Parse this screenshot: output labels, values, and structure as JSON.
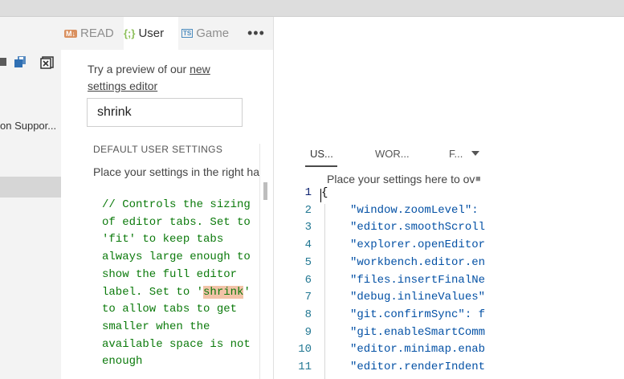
{
  "sidebar": {
    "text": "on Suppor..."
  },
  "tabs": [
    {
      "icon": "M↓",
      "label": "READ"
    },
    {
      "icon": "{;}",
      "label": "User"
    },
    {
      "icon": "TS",
      "label": "Game"
    }
  ],
  "tabs_more": "•••",
  "preview": {
    "text": "Try a preview of our ",
    "link": "new settings editor"
  },
  "search": {
    "value": "shrink"
  },
  "default_settings": {
    "header": "DEFAULT USER SETTINGS",
    "place_text": "Place your settings in the right ha",
    "comment_before": "// Controls the sizing of editor tabs. Set to 'fit' to keep tabs always large enough to show the full editor label. Set to '",
    "comment_highlight": "shrink",
    "comment_after": "' to allow tabs to get smaller when the available space is not enough"
  },
  "right_tabs": {
    "user": "US...",
    "workspace": "WOR...",
    "folder": "F..."
  },
  "right_place_text": "Place your settings here to ov",
  "code_lines": [
    {
      "num": "1",
      "text": "{"
    },
    {
      "num": "2",
      "text": "\"window.zoomLevel\": "
    },
    {
      "num": "3",
      "text": "\"editor.smoothScroll"
    },
    {
      "num": "4",
      "text": "\"explorer.openEditor"
    },
    {
      "num": "5",
      "text": "\"workbench.editor.en"
    },
    {
      "num": "6",
      "text": "\"files.insertFinalNe"
    },
    {
      "num": "7",
      "text": "\"debug.inlineValues\""
    },
    {
      "num": "8",
      "text": "\"git.confirmSync\": f"
    },
    {
      "num": "9",
      "text": "\"git.enableSmartComm"
    },
    {
      "num": "10",
      "text": "\"editor.minimap.enab"
    },
    {
      "num": "11",
      "text": "\"editor.renderIndent"
    }
  ]
}
